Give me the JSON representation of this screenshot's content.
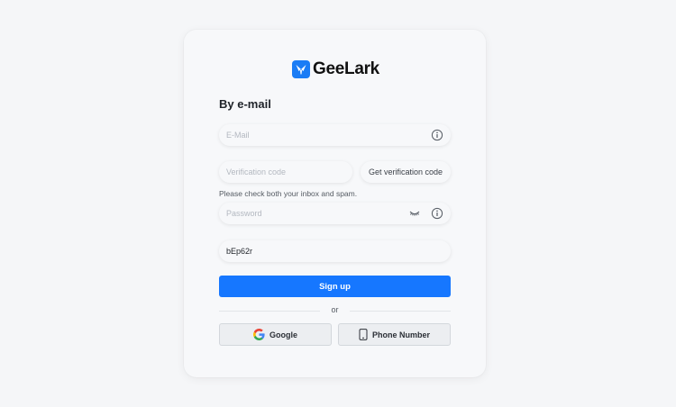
{
  "brand": {
    "name": "GeeLark",
    "accent": "#1677ff"
  },
  "form": {
    "title": "By e-mail",
    "email_placeholder": "E-Mail",
    "code_placeholder": "Verification code",
    "get_code_label": "Get verification code",
    "hint": "Please check both your inbox and spam.",
    "password_placeholder": "Password",
    "captcha_value": "bEp62r",
    "signup_label": "Sign up"
  },
  "alt": {
    "or_label": "or",
    "google_label": "Google",
    "phone_label": "Phone Number"
  },
  "icons": {
    "info": "info-icon",
    "eye_closed": "eye-closed-icon",
    "google": "google-icon",
    "phone": "phone-icon"
  }
}
